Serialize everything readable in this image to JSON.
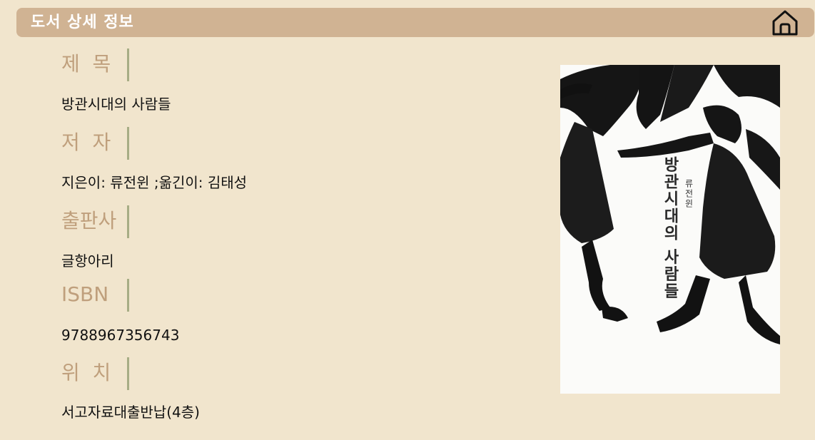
{
  "header": {
    "title": "도서 상세 정보"
  },
  "fields": {
    "title": {
      "label": "제  목",
      "value": "방관시대의 사람들"
    },
    "author": {
      "label": "저  자",
      "value": "지은이: 류전윈 ;옮긴이: 김태성"
    },
    "publisher": {
      "label": "출판사",
      "value": "글항아리"
    },
    "isbn": {
      "label": "ISBN",
      "value": "9788967356743"
    },
    "location": {
      "label": "위  치",
      "value": "서고자료대출반납(4층)"
    }
  },
  "cover": {
    "title_text": "방관시대의 사람들",
    "author_text": "류전윈"
  },
  "colors": {
    "background": "#f1e5cd",
    "header": "#d0b393",
    "label": "#bf9f7c",
    "divider": "#a7ad85"
  },
  "icons": {
    "home": "home-icon"
  }
}
